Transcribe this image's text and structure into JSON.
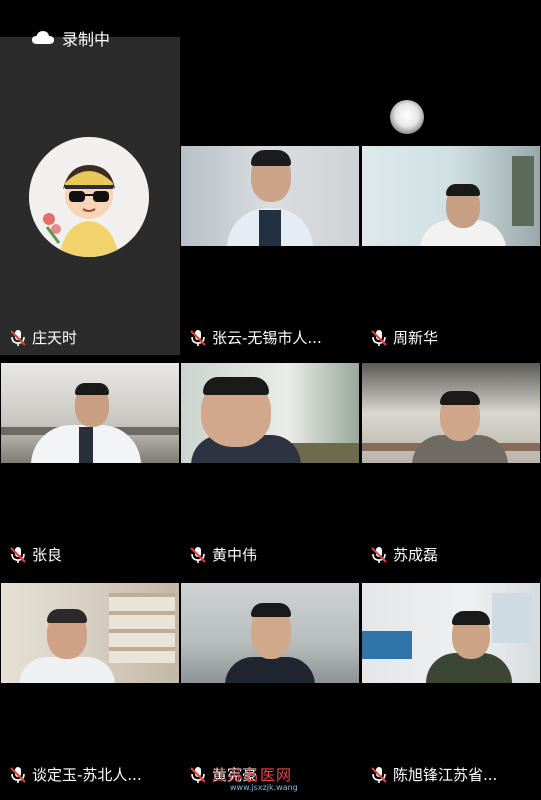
{
  "recording": {
    "label": "录制中"
  },
  "participants": [
    {
      "name": "庄天时"
    },
    {
      "name": "张云-无锡市人..."
    },
    {
      "name": "周新华"
    },
    {
      "name": "张良"
    },
    {
      "name": "黄中伟"
    },
    {
      "name": "苏成磊"
    },
    {
      "name": "谈定玉-苏北人..."
    },
    {
      "name": "黄宪豪"
    },
    {
      "name": "陈旭锋江苏省..."
    }
  ],
  "watermark": {
    "text": "江苏名医网",
    "sub": "www.jsxzjk.wang"
  },
  "colors": {
    "tile_bg": "#000000",
    "avatar_tile_bg": "#2b2b2b",
    "mic_icon": "#ffffff",
    "mic_slash": "#e0443b"
  }
}
